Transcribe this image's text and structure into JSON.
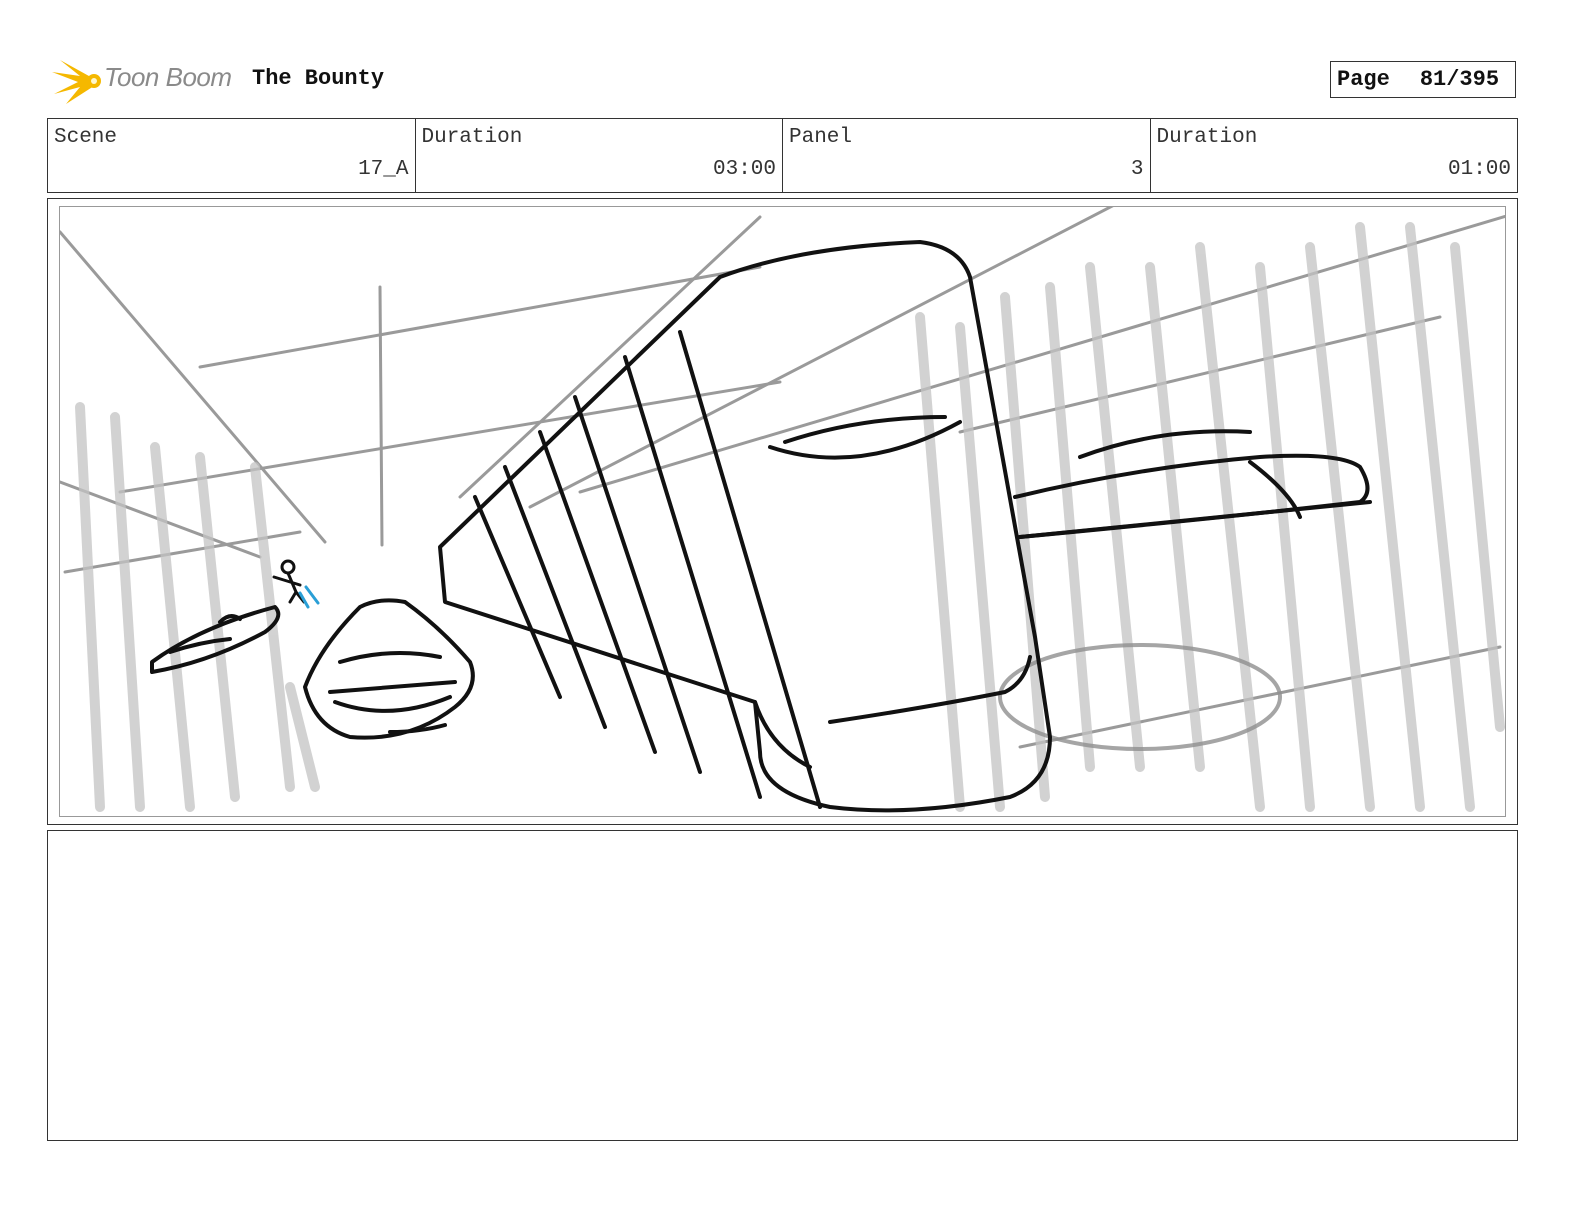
{
  "header": {
    "logo_text": "Toon Boom",
    "project_title": "The Bounty",
    "page_label": "Page",
    "page_number": "81/395"
  },
  "info": {
    "scene_label": "Scene",
    "scene_value": "17_A",
    "scene_duration_label": "Duration",
    "scene_duration_value": "03:00",
    "panel_label": "Panel",
    "panel_value": "3",
    "panel_duration_label": "Duration",
    "panel_duration_value": "01:00"
  },
  "colors": {
    "logo_star": "#f5b800",
    "logo_text": "#8a8a8a",
    "sketch_dark": "#111111",
    "sketch_light": "#9a9a9a",
    "sketch_accent": "#2a9fd6"
  }
}
